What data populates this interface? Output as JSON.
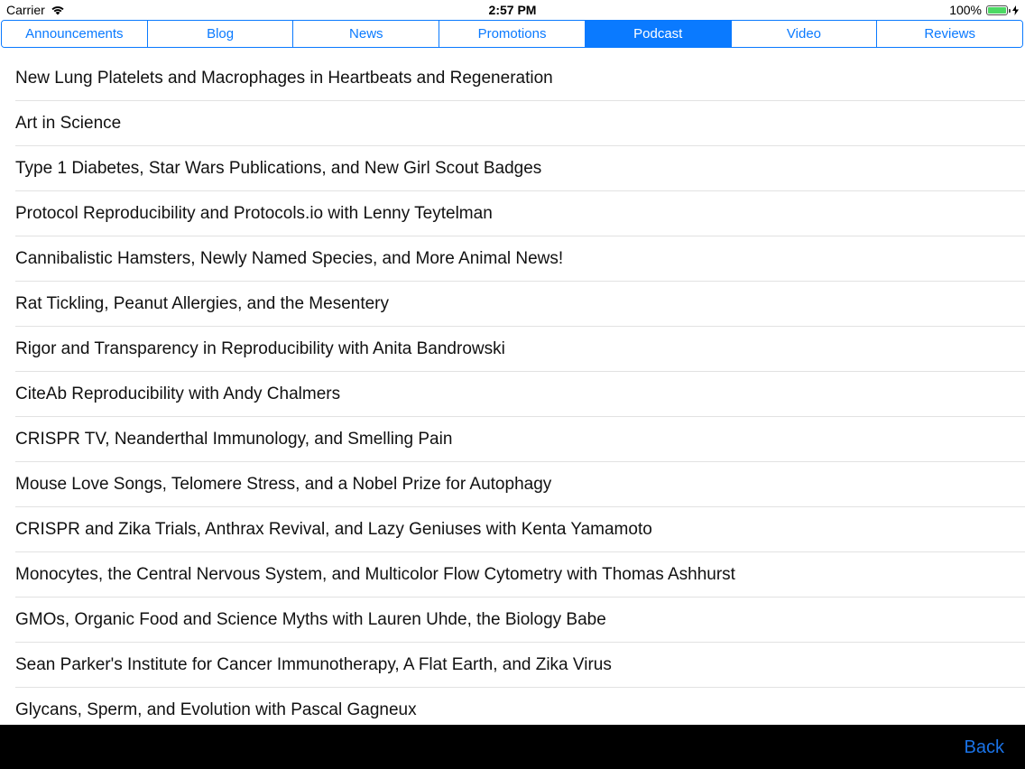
{
  "status_bar": {
    "carrier": "Carrier",
    "time": "2:57 PM",
    "battery": "100%"
  },
  "tabs": [
    {
      "label": "Announcements",
      "active": false
    },
    {
      "label": "Blog",
      "active": false
    },
    {
      "label": "News",
      "active": false
    },
    {
      "label": "Promotions",
      "active": false
    },
    {
      "label": "Podcast",
      "active": true
    },
    {
      "label": "Video",
      "active": false
    },
    {
      "label": "Reviews",
      "active": false
    }
  ],
  "items": [
    "New Lung Platelets and Macrophages in Heartbeats and Regeneration",
    "Art in Science",
    "Type 1 Diabetes, Star Wars Publications, and New Girl Scout Badges",
    "Protocol Reproducibility and Protocols.io with Lenny Teytelman",
    "Cannibalistic Hamsters, Newly Named Species, and More Animal News!",
    "Rat Tickling, Peanut Allergies, and the Mesentery",
    "Rigor and Transparency in Reproducibility with Anita Bandrowski",
    "CiteAb Reproducibility with Andy Chalmers",
    "CRISPR TV, Neanderthal Immunology, and Smelling Pain",
    "Mouse Love Songs, Telomere Stress, and a Nobel Prize for Autophagy",
    "CRISPR and Zika Trials, Anthrax Revival, and Lazy Geniuses with Kenta Yamamoto",
    "Monocytes, the Central Nervous System, and Multicolor Flow Cytometry with Thomas Ashhurst",
    "GMOs, Organic Food and Science Myths with Lauren Uhde, the Biology Babe",
    "Sean Parker's Institute for Cancer Immunotherapy, A Flat Earth, and Zika Virus",
    "Glycans, Sperm, and Evolution with Pascal Gagneux"
  ],
  "toolbar": {
    "back_label": "Back"
  },
  "colors": {
    "accent": "#0a7aff",
    "battery": "#4cd964",
    "toolbar_bg": "#000000"
  }
}
